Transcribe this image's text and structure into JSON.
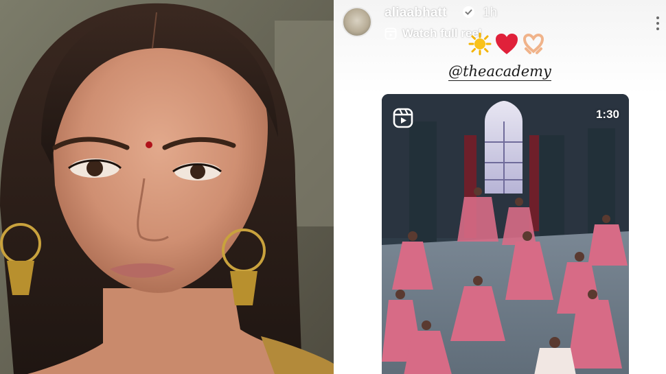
{
  "story": {
    "username": "aliaabhatt",
    "time_ago": "1h",
    "reel_link_label": "Watch full reel",
    "mention": "@theacademy",
    "emojis": [
      "sun",
      "red-heart",
      "heart-hands"
    ],
    "reel_duration": "1:30"
  },
  "icons": {
    "verified": "verified-badge-icon",
    "reel": "reels-icon",
    "more": "more-options-icon"
  },
  "colors": {
    "verified": "#3897f0",
    "heart": "#e0213a",
    "story_bg": "#ffffff"
  }
}
